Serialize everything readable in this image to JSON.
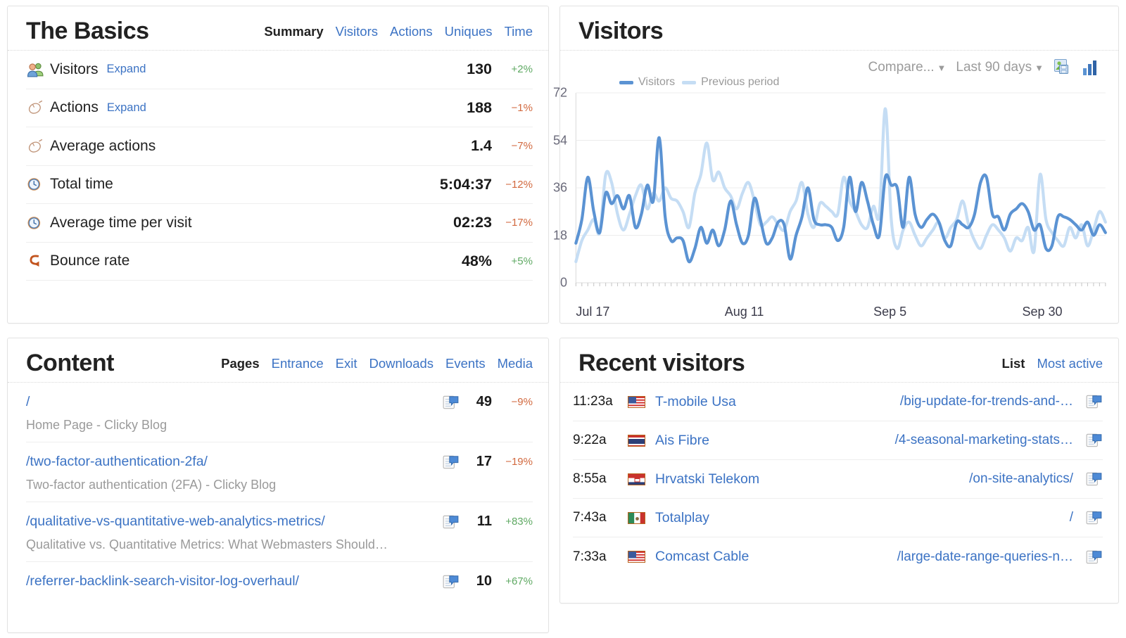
{
  "colors": {
    "link": "#3c73c4",
    "positive": "#5fa963",
    "negative": "#d2693f",
    "series_current": "#5b93d3",
    "series_previous": "#c5ddf4",
    "muted": "#9a9a9a"
  },
  "basics": {
    "title": "The Basics",
    "tabs": [
      {
        "label": "Summary",
        "active": true
      },
      {
        "label": "Visitors",
        "active": false
      },
      {
        "label": "Actions",
        "active": false
      },
      {
        "label": "Uniques",
        "active": false
      },
      {
        "label": "Time",
        "active": false
      }
    ],
    "rows": [
      {
        "icon": "visitors-icon",
        "label": "Visitors",
        "expand": "Expand",
        "value": "130",
        "pct": "+2%",
        "dir": "pos"
      },
      {
        "icon": "mouse-icon",
        "label": "Actions",
        "expand": "Expand",
        "value": "188",
        "pct": "−1%",
        "dir": "neg"
      },
      {
        "icon": "mouse-icon",
        "label": "Average actions",
        "expand": "",
        "value": "1.4",
        "pct": "−7%",
        "dir": "neg"
      },
      {
        "icon": "clock-icon",
        "label": "Total time",
        "expand": "",
        "value": "5:04:37",
        "pct": "−12%",
        "dir": "neg"
      },
      {
        "icon": "clock-icon",
        "label": "Average time per visit",
        "expand": "",
        "value": "02:23",
        "pct": "−17%",
        "dir": "neg"
      },
      {
        "icon": "bounce-icon",
        "label": "Bounce rate",
        "expand": "",
        "value": "48%",
        "pct": "+5%",
        "dir": "pos"
      }
    ]
  },
  "content": {
    "title": "Content",
    "tabs": [
      {
        "label": "Pages",
        "active": true
      },
      {
        "label": "Entrance",
        "active": false
      },
      {
        "label": "Exit",
        "active": false
      },
      {
        "label": "Downloads",
        "active": false
      },
      {
        "label": "Events",
        "active": false
      },
      {
        "label": "Media",
        "active": false
      }
    ],
    "rows": [
      {
        "url": "/",
        "title": "Home Page - Clicky Blog",
        "value": "49",
        "pct": "−9%",
        "dir": "neg"
      },
      {
        "url": "/two-factor-authentication-2fa/",
        "title": "Two-factor authentication (2FA) - Clicky Blog",
        "value": "17",
        "pct": "−19%",
        "dir": "neg"
      },
      {
        "url": "/qualitative-vs-quantitative-web-analytics-metrics/",
        "title": "Qualitative vs. Quantitative Metrics: What Webmasters Should…",
        "value": "11",
        "pct": "+83%",
        "dir": "pos"
      },
      {
        "url": "/referrer-backlink-search-visitor-log-overhaul/",
        "title": "",
        "value": "10",
        "pct": "+67%",
        "dir": "pos"
      }
    ]
  },
  "visitors_panel": {
    "title": "Visitors",
    "compare_label": "Compare...",
    "range_label": "Last 90 days",
    "save_icon": "save-image-icon",
    "chart_type_icon": "bar-chart-icon"
  },
  "recent": {
    "title": "Recent visitors",
    "tabs": [
      {
        "label": "List",
        "active": true
      },
      {
        "label": "Most active",
        "active": false
      }
    ],
    "rows": [
      {
        "time": "11:23a",
        "flag": "us",
        "org": "T-mobile Usa",
        "path": "/big-update-for-trends-and-…"
      },
      {
        "time": "9:22a",
        "flag": "th",
        "org": "Ais Fibre",
        "path": "/4-seasonal-marketing-stats…"
      },
      {
        "time": "8:55a",
        "flag": "hr",
        "org": "Hrvatski Telekom",
        "path": "/on-site-analytics/"
      },
      {
        "time": "7:43a",
        "flag": "mx",
        "org": "Totalplay",
        "path": "/"
      },
      {
        "time": "7:33a",
        "flag": "us",
        "org": "Comcast Cable",
        "path": "/large-date-range-queries-n…"
      }
    ]
  },
  "chart_data": {
    "type": "line",
    "title": "Visitors",
    "xlabel": "",
    "ylabel": "",
    "ylim": [
      0,
      72
    ],
    "yticks": [
      0,
      18,
      36,
      54,
      72
    ],
    "grid": true,
    "legend_position": "top-left",
    "xticks": [
      "Jul 17",
      "Aug 11",
      "Sep 5",
      "Sep 30"
    ],
    "xtick_index": [
      0,
      25,
      50,
      75
    ],
    "series": [
      {
        "name": "Visitors",
        "color": "#5b93d3",
        "values": [
          15,
          24,
          40,
          27,
          19,
          34,
          30,
          33,
          28,
          33,
          21,
          26,
          37,
          31,
          55,
          25,
          16,
          17,
          16,
          8,
          13,
          21,
          15,
          20,
          14,
          20,
          31,
          22,
          15,
          18,
          32,
          24,
          15,
          17,
          23,
          22,
          9,
          18,
          25,
          36,
          24,
          22,
          22,
          21,
          16,
          21,
          40,
          27,
          38,
          31,
          22,
          18,
          40,
          37,
          36,
          21,
          40,
          26,
          21,
          24,
          26,
          23,
          16,
          14,
          23,
          22,
          21,
          26,
          38,
          40,
          26,
          25,
          20,
          26,
          28,
          30,
          27,
          20,
          22,
          13,
          14,
          25,
          25,
          24,
          22,
          20,
          23,
          18,
          22,
          19
        ]
      },
      {
        "name": "Previous period",
        "color": "#c5ddf4",
        "values": [
          8,
          16,
          20,
          24,
          19,
          41,
          38,
          26,
          20,
          26,
          33,
          37,
          28,
          34,
          31,
          36,
          32,
          31,
          27,
          21,
          34,
          41,
          53,
          39,
          42,
          36,
          33,
          28,
          34,
          38,
          31,
          22,
          23,
          25,
          22,
          20,
          27,
          31,
          38,
          26,
          21,
          30,
          29,
          27,
          26,
          40,
          31,
          27,
          22,
          21,
          29,
          26,
          66,
          24,
          13,
          20,
          23,
          18,
          14,
          17,
          20,
          23,
          17,
          21,
          24,
          31,
          22,
          16,
          13,
          18,
          22,
          20,
          17,
          12,
          17,
          16,
          21,
          12,
          41,
          24,
          19,
          16,
          14,
          21,
          17,
          22,
          14,
          20,
          27,
          23
        ]
      }
    ]
  }
}
